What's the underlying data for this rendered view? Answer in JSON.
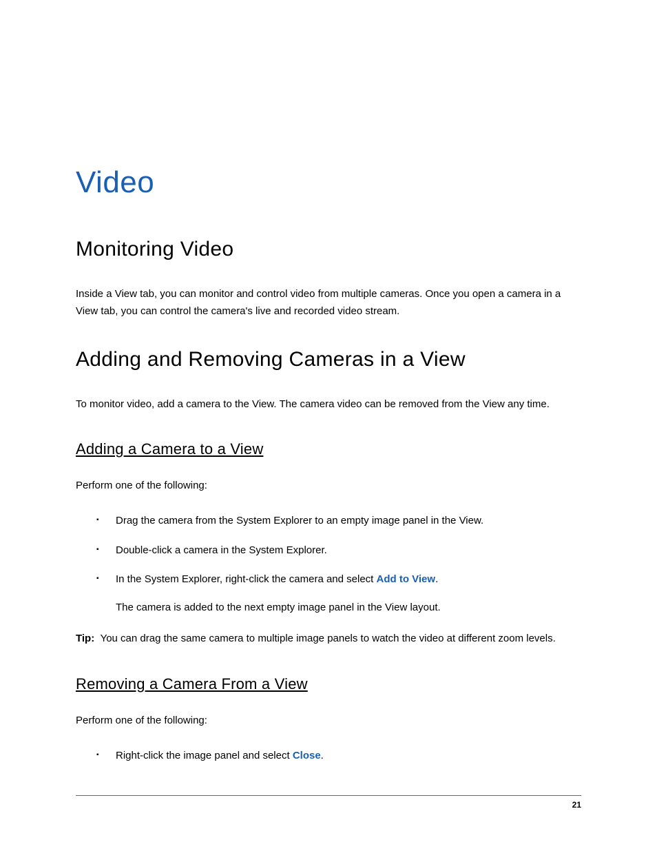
{
  "title": "Video",
  "sec1": {
    "heading": "Monitoring Video",
    "p1": "Inside a View tab, you can monitor and control video from multiple cameras. Once you open a camera in a View tab, you can control the camera's live and recorded video stream."
  },
  "sec2": {
    "heading": "Adding and Removing Cameras in a View",
    "p1": "To monitor video, add a camera to the View. The camera video can be removed from the View any time.",
    "sub1": {
      "heading": "Adding a Camera to a View",
      "intro": "Perform one of the following:",
      "items": {
        "i1": "Drag the camera from the System Explorer to an empty image panel in the View.",
        "i2": "Double-click a camera in the System Explorer.",
        "i3_pre": "In the System Explorer, right-click the camera and select ",
        "i3_link": "Add to View",
        "i3_post": ".",
        "i3_note": "The camera is added to the next empty image panel in the View layout."
      },
      "tip_label": "Tip:",
      "tip_text": "You can drag the same camera to multiple image panels to watch the video at different zoom levels."
    },
    "sub2": {
      "heading": "Removing a Camera From a View",
      "intro": "Perform one of the following:",
      "items": {
        "i1_pre": "Right-click the image panel and select ",
        "i1_link": "Close",
        "i1_post": "."
      }
    }
  },
  "page_number": "21"
}
